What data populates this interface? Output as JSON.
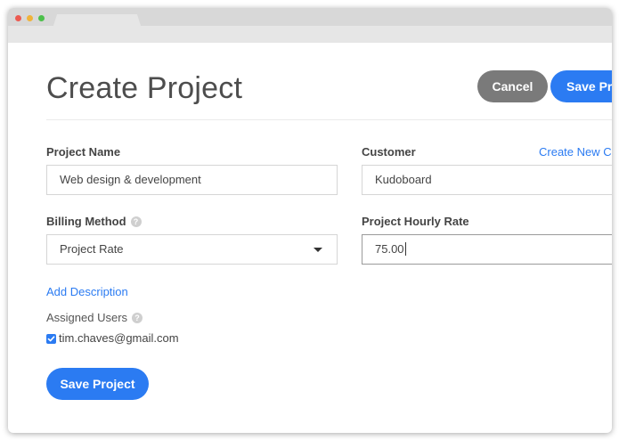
{
  "page": {
    "title": "Create Project"
  },
  "header": {
    "cancel_label": "Cancel",
    "save_label": "Save Pro"
  },
  "form": {
    "project_name": {
      "label": "Project Name",
      "value": "Web design & development"
    },
    "customer": {
      "label": "Customer",
      "value": "Kudoboard",
      "create_new_label": "Create New C"
    },
    "billing_method": {
      "label": "Billing Method",
      "selected": "Project Rate"
    },
    "hourly_rate": {
      "label": "Project Hourly Rate",
      "value": "75.00"
    },
    "add_description_label": "Add Description",
    "assigned_users": {
      "label": "Assigned Users",
      "users": [
        {
          "email": "tim.chaves@gmail.com",
          "checked": true
        }
      ]
    },
    "save_label": "Save Project"
  },
  "icons": {
    "help": "?"
  },
  "colors": {
    "accent": "#2b7bf2",
    "cancel": "#7a7a7a"
  }
}
